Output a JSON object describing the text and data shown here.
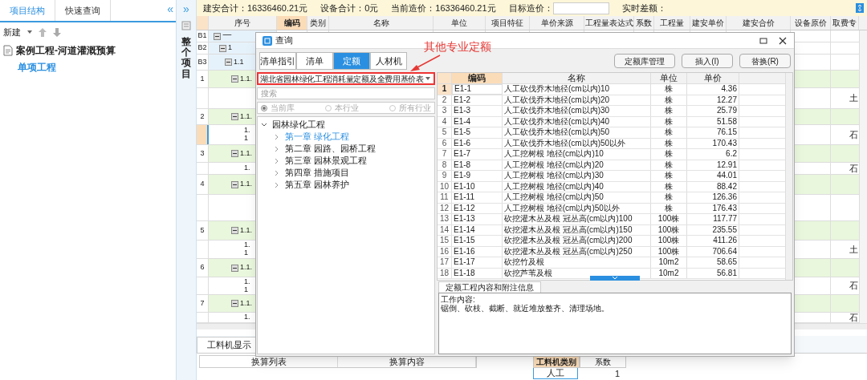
{
  "sidebar": {
    "tabs": [
      {
        "label": "项目结构",
        "selected": true
      },
      {
        "label": "快速查询",
        "selected": false
      }
    ],
    "collapse": "«",
    "new_label": "新建",
    "tree": [
      {
        "label": "案例工程-河道灌溉预算",
        "children": [
          {
            "label": "单项工程",
            "selected": true
          }
        ]
      }
    ]
  },
  "side_strip": {
    "expand": "»",
    "label": "整个项目"
  },
  "summary_bar": [
    {
      "kind": "text",
      "label": "建安合计：16336460.21元"
    },
    {
      "kind": "text",
      "label": "设备合计：0元"
    },
    {
      "kind": "text",
      "label": "当前造价：16336460.21元"
    },
    {
      "kind": "field",
      "label": "目标造价："
    },
    {
      "kind": "text",
      "label": "实时差额："
    }
  ],
  "table": {
    "columns": [
      {
        "label": "序号",
        "selected": false
      },
      {
        "label": "编码",
        "selected": true
      },
      {
        "label": "类别",
        "selected": false
      },
      {
        "label": "名称",
        "selected": false
      },
      {
        "label": "单位",
        "selected": false
      },
      {
        "label": "项目特征",
        "selected": false
      },
      {
        "label": "单价来源",
        "selected": false
      },
      {
        "label": "工程量表达式",
        "selected": false
      },
      {
        "label": "系数",
        "selected": false
      },
      {
        "label": "工程量",
        "selected": false
      },
      {
        "label": "建安单价",
        "selected": false
      },
      {
        "label": "建安合价",
        "selected": false
      },
      {
        "label": "设备原价",
        "selected": false
      },
      {
        "label": "取费专",
        "selected": false
      }
    ],
    "rows": [
      {
        "kind": "group",
        "label": "B1",
        "seq": [
          "一"
        ],
        "selected": false
      },
      {
        "kind": "group",
        "label": "B2",
        "seq": [
          "1"
        ],
        "selected": false
      },
      {
        "kind": "group",
        "label": "B3",
        "seq": [
          "1.1"
        ],
        "selected": false
      },
      {
        "kind": "item",
        "label": "1",
        "seq": [
          "1.1."
        ],
        "selected": false
      },
      {
        "kind": "child",
        "fee": "土",
        "selected": false
      },
      {
        "kind": "item",
        "label": "2",
        "seq": [
          "1.1."
        ],
        "selected": false
      },
      {
        "kind": "child",
        "seq": [
          "1.",
          "1"
        ],
        "fee": "石",
        "selected": true
      },
      {
        "kind": "item",
        "label": "3",
        "seq": [
          "1.1."
        ],
        "selected": false
      },
      {
        "kind": "child",
        "seq": [
          "1."
        ],
        "fee": "石",
        "selected": false
      },
      {
        "kind": "item",
        "label": "4",
        "seq": [
          "1.1."
        ],
        "selected": false
      },
      {
        "kind": "child",
        "selected": false
      },
      {
        "kind": "item",
        "label": "5",
        "seq": [
          "1.1."
        ],
        "selected": false
      },
      {
        "kind": "child",
        "seq": [
          "1.",
          "1"
        ],
        "fee": "土",
        "selected": false
      },
      {
        "kind": "item",
        "label": "6",
        "seq": [
          "1.1."
        ],
        "selected": false
      },
      {
        "kind": "child",
        "seq": [
          "1.",
          "1"
        ],
        "fee": "石",
        "selected": false
      },
      {
        "kind": "item",
        "label": "7",
        "seq": [
          "1.1."
        ],
        "selected": false
      },
      {
        "kind": "child",
        "seq": [
          "1."
        ],
        "fee": "石",
        "selected": false
      }
    ]
  },
  "bottom_panel": {
    "tabs": [
      {
        "label": "工料机显示",
        "selected": true
      }
    ],
    "left_columns": [
      "换算列表",
      "换算内容"
    ],
    "right_columns": [
      "工料机类别",
      "系数"
    ],
    "right_rows": [
      {
        "category": "人工",
        "factor": "1"
      }
    ]
  },
  "dialog": {
    "title": "查询",
    "tabs": [
      {
        "label": "清单指引",
        "selected": false
      },
      {
        "label": "清单",
        "selected": false
      },
      {
        "label": "定额",
        "selected": true
      },
      {
        "label": "人材机",
        "selected": false
      }
    ],
    "buttons": [
      "定额库管理",
      "插入(I)",
      "替换(R)"
    ],
    "library": "湖北省园林绿化工程消耗量定额及全费用基价表",
    "search": {
      "placeholder": "搜索"
    },
    "scopes": [
      {
        "label": "当前库",
        "selected": true,
        "disabled": true
      },
      {
        "label": "本行业",
        "selected": false,
        "disabled": true
      },
      {
        "label": "所有行业",
        "selected": false,
        "disabled": true
      }
    ],
    "tree": [
      {
        "label": "园林绿化工程",
        "expanded": true,
        "children": [
          {
            "label": "第一章 绿化工程",
            "selected": true,
            "expanded": false
          },
          {
            "label": "第二章 园路、园桥工程",
            "selected": false,
            "expanded": false
          },
          {
            "label": "第三章 园林景观工程",
            "selected": false,
            "expanded": false
          },
          {
            "label": "第四章 措施项目",
            "selected": false,
            "expanded": false
          },
          {
            "label": "第五章 园林养护",
            "selected": false,
            "expanded": false
          }
        ]
      }
    ],
    "columns": [
      "编码",
      "名称",
      "单位",
      "单价"
    ],
    "rows": [
      {
        "n": "1",
        "code": "E1-1",
        "name": "人工砍伐乔木地径(cm以内)10",
        "unit": "株",
        "price": "4.36",
        "selected": true
      },
      {
        "n": "2",
        "code": "E1-2",
        "name": "人工砍伐乔木地径(cm以内)20",
        "unit": "株",
        "price": "12.27",
        "selected": false
      },
      {
        "n": "3",
        "code": "E1-3",
        "name": "人工砍伐乔木地径(cm以内)30",
        "unit": "株",
        "price": "25.79",
        "selected": false
      },
      {
        "n": "4",
        "code": "E1-4",
        "name": "人工砍伐乔木地径(cm以内)40",
        "unit": "株",
        "price": "51.58",
        "selected": false
      },
      {
        "n": "5",
        "code": "E1-5",
        "name": "人工砍伐乔木地径(cm以内)50",
        "unit": "株",
        "price": "76.15",
        "selected": false
      },
      {
        "n": "6",
        "code": "E1-6",
        "name": "人工砍伐乔木地径(cm以内)50以外",
        "unit": "株",
        "price": "170.43",
        "selected": false
      },
      {
        "n": "7",
        "code": "E1-7",
        "name": "人工挖树根 地径(cm以内)10",
        "unit": "株",
        "price": "6.2",
        "selected": false
      },
      {
        "n": "8",
        "code": "E1-8",
        "name": "人工挖树根 地径(cm以内)20",
        "unit": "株",
        "price": "12.91",
        "selected": false
      },
      {
        "n": "9",
        "code": "E1-9",
        "name": "人工挖树根 地径(cm以内)30",
        "unit": "株",
        "price": "44.01",
        "selected": false
      },
      {
        "n": "10",
        "code": "E1-10",
        "name": "人工挖树根 地径(cm以内)40",
        "unit": "株",
        "price": "88.42",
        "selected": false
      },
      {
        "n": "11",
        "code": "E1-11",
        "name": "人工挖树根 地径(cm以内)50",
        "unit": "株",
        "price": "126.36",
        "selected": false
      },
      {
        "n": "12",
        "code": "E1-12",
        "name": "人工挖树根 地径(cm以内)50以外",
        "unit": "株",
        "price": "176.43",
        "selected": false
      },
      {
        "n": "13",
        "code": "E1-13",
        "name": "砍挖灌木丛及根 冠丛高(cm以内)100",
        "unit": "100株",
        "price": "117.77",
        "selected": false
      },
      {
        "n": "14",
        "code": "E1-14",
        "name": "砍挖灌木丛及根 冠丛高(cm以内)150",
        "unit": "100株",
        "price": "235.55",
        "selected": false
      },
      {
        "n": "15",
        "code": "E1-15",
        "name": "砍挖灌木丛及根 冠丛高(cm以内)200",
        "unit": "100株",
        "price": "411.26",
        "selected": false
      },
      {
        "n": "16",
        "code": "E1-16",
        "name": "砍挖灌木丛及根 冠丛高(cm以内)250",
        "unit": "100株",
        "price": "706.64",
        "selected": false
      },
      {
        "n": "17",
        "code": "E1-17",
        "name": "砍挖竹及根",
        "unit": "10m2",
        "price": "58.65",
        "selected": false
      },
      {
        "n": "18",
        "code": "E1-18",
        "name": "砍挖芦苇及根",
        "unit": "10m2",
        "price": "56.81",
        "selected": false
      }
    ],
    "info_tab": "定额工程内容和附注信息",
    "info_lines": [
      "工作内容:",
      "锯倒、砍枝、截断、就近堆放整齐、清理场地。"
    ]
  },
  "annotation": {
    "text": "其他专业定额"
  }
}
